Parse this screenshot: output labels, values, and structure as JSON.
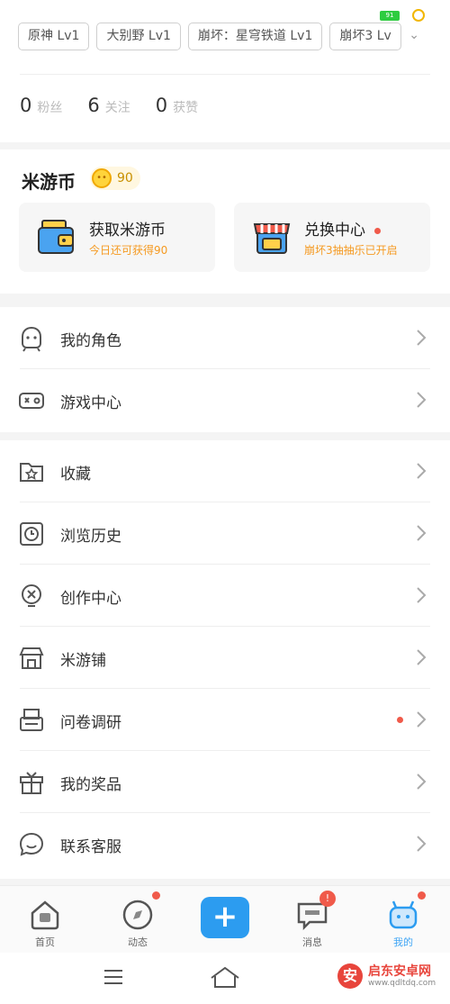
{
  "status": {
    "battery": "91"
  },
  "game_tags": [
    "原神 Lv1",
    "大别野 Lv1",
    "崩坏：星穹铁道 Lv1",
    "崩坏3 Lv"
  ],
  "tags_more": "⌄",
  "stats": [
    {
      "num": "0",
      "label": "粉丝"
    },
    {
      "num": "6",
      "label": "关注"
    },
    {
      "num": "0",
      "label": "获赞"
    }
  ],
  "coin": {
    "title": "米游币",
    "value": "90",
    "earn": {
      "title": "获取米游币",
      "sub": "今日还可获得90"
    },
    "exchange": {
      "title": "兑换中心",
      "sub": "崩坏3抽抽乐已开启"
    }
  },
  "menu_group1": [
    {
      "label": "我的角色",
      "icon": "character-icon"
    },
    {
      "label": "游戏中心",
      "icon": "gamepad-icon"
    }
  ],
  "menu_group2": [
    {
      "label": "收藏",
      "icon": "favorites-folder-icon"
    },
    {
      "label": "浏览历史",
      "icon": "clock-icon"
    },
    {
      "label": "创作中心",
      "icon": "creation-bulb-icon"
    },
    {
      "label": "米游铺",
      "icon": "store-icon"
    },
    {
      "label": "问卷调研",
      "icon": "survey-printer-icon"
    },
    {
      "label": "我的奖品",
      "icon": "gift-icon"
    },
    {
      "label": "联系客服",
      "icon": "customer-service-icon"
    }
  ],
  "tabbar": {
    "home": "首页",
    "feed": "动态",
    "plus": "+",
    "messages": "消息",
    "messages_badge": "!",
    "me": "我的"
  },
  "watermark": {
    "name": "启东安卓网",
    "url": "www.qdltdq.com",
    "logo": "安"
  },
  "colors": {
    "accent": "#2c9cf0",
    "orange": "#f59a22",
    "red": "#f05a4a"
  }
}
